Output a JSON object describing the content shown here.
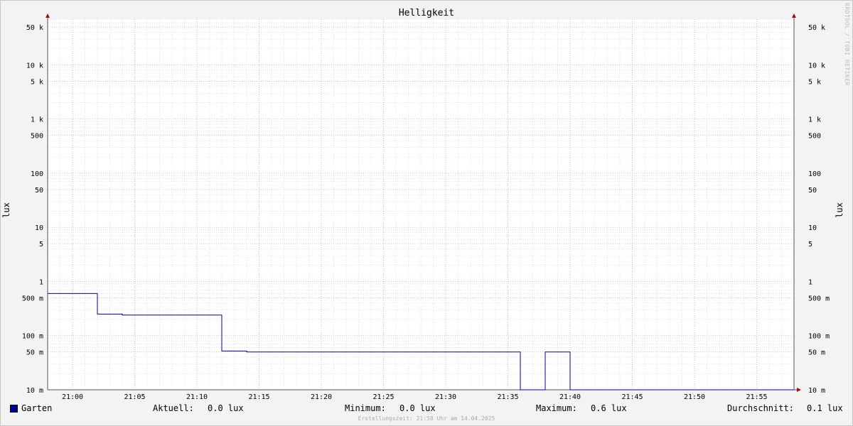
{
  "chart_data": {
    "type": "line",
    "title": "Helligkeit",
    "ylabel": "lux",
    "ylabel_right": "lux",
    "yscale": "log",
    "ylim": [
      0.01,
      70000
    ],
    "x_ticks": [
      "21:00",
      "21:05",
      "21:10",
      "21:15",
      "21:20",
      "21:25",
      "21:30",
      "21:35",
      "21:40",
      "21:45",
      "21:50",
      "21:55"
    ],
    "xlim": [
      "20:58",
      "21:58"
    ],
    "y_ticks": [
      {
        "value": 50000,
        "label": "50 k"
      },
      {
        "value": 10000,
        "label": "10 k"
      },
      {
        "value": 5000,
        "label": "5 k"
      },
      {
        "value": 1000,
        "label": "1 k"
      },
      {
        "value": 500,
        "label": "500"
      },
      {
        "value": 100,
        "label": "100"
      },
      {
        "value": 50,
        "label": "50"
      },
      {
        "value": 10,
        "label": "10"
      },
      {
        "value": 5,
        "label": "5"
      },
      {
        "value": 1,
        "label": "1"
      },
      {
        "value": 0.5,
        "label": "500 m"
      },
      {
        "value": 0.1,
        "label": "100 m"
      },
      {
        "value": 0.05,
        "label": "50 m"
      },
      {
        "value": 0.01,
        "label": "10 m"
      }
    ],
    "grid": true,
    "series": [
      {
        "name": "Garten",
        "color": "#0000a0",
        "points": [
          {
            "x": "20:58",
            "y": 0.6
          },
          {
            "x": "21:02",
            "y": 0.6
          },
          {
            "x": "21:02",
            "y": 0.25
          },
          {
            "x": "21:04",
            "y": 0.25
          },
          {
            "x": "21:04",
            "y": 0.24
          },
          {
            "x": "21:12",
            "y": 0.24
          },
          {
            "x": "21:12",
            "y": 0.052
          },
          {
            "x": "21:14",
            "y": 0.052
          },
          {
            "x": "21:14",
            "y": 0.05
          },
          {
            "x": "21:36",
            "y": 0.05
          },
          {
            "x": "21:36",
            "y": 0.01
          },
          {
            "x": "21:38",
            "y": 0.01
          },
          {
            "x": "21:38",
            "y": 0.05
          },
          {
            "x": "21:40",
            "y": 0.05
          },
          {
            "x": "21:40",
            "y": 0.01
          },
          {
            "x": "21:58",
            "y": 0.01
          }
        ]
      }
    ]
  },
  "watermark": "RRDTOOL / TOBI OETIKER",
  "legend": {
    "series_name": "Garten",
    "current_label": "Aktuell:",
    "current_value": "0.0 lux",
    "min_label": "Minimum:",
    "min_value": "0.0 lux",
    "max_label": "Maximum:",
    "max_value": "0.6 lux",
    "avg_label": "Durchschnitt:",
    "avg_value": "0.1 lux"
  },
  "footer": "Erstellungszeit: 21:58 Uhr am 14.04.2025",
  "colors": {
    "line": "#0000a0",
    "grid_major": "#e6a0a0",
    "grid_minor": "#d0d0d0",
    "arrow": "#a01010"
  }
}
